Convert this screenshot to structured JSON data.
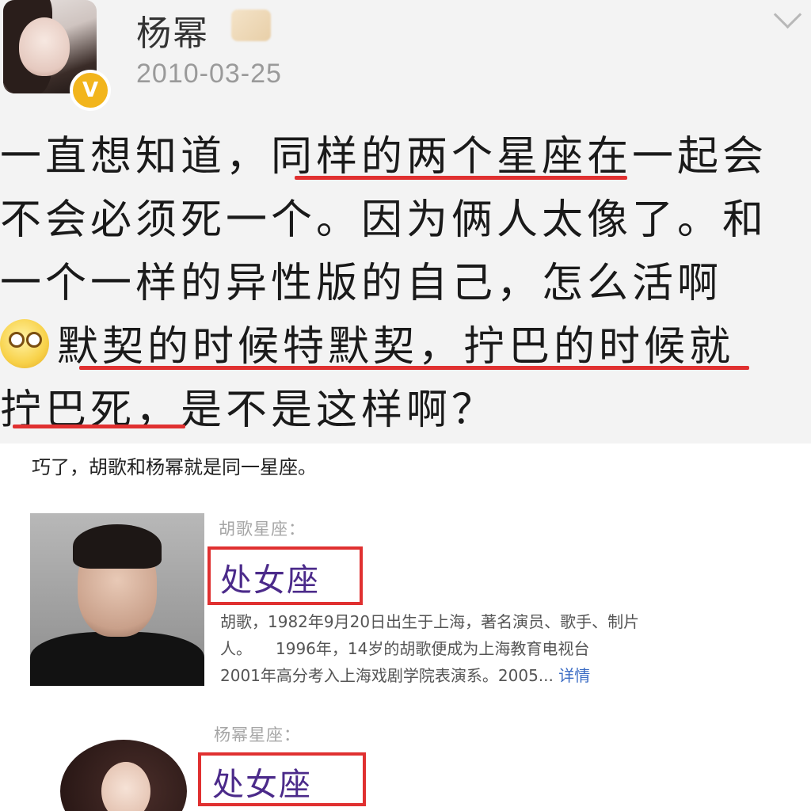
{
  "post": {
    "username": "杨幂",
    "date": "2010-03-25",
    "verified_badge": "V",
    "icons": [
      "avatar",
      "verified-badge-icon",
      "member-crown-icon",
      "chevron-down-icon",
      "emoji-icon"
    ],
    "lines": [
      "一直想知道，同样的两个星座在一起会",
      "不会必须死一个。因为俩人太像了。和",
      "一个一样的异性版的自己，怎么活啊",
      "默契的时候特默契，拧巴的时候就",
      "拧巴死，是不是这样啊？"
    ],
    "highlight_color": "#e03030"
  },
  "caption": "巧了，胡歌和杨幂就是同一星座。",
  "hu_ge": {
    "label": "胡歌星座：",
    "sign": "处女座",
    "bio_line1": "胡歌，1982年9月20日出生于上海，著名演员、歌手、制片",
    "bio_line2": "人。　　1996年，14岁的胡歌便成为上海教育电视台",
    "bio_line3_text": "2001年高分考入上海戏剧学院表演系。2005... ",
    "bio_more": "详情"
  },
  "yang_mi": {
    "label": "杨幂星座：",
    "sign": "处女座"
  }
}
